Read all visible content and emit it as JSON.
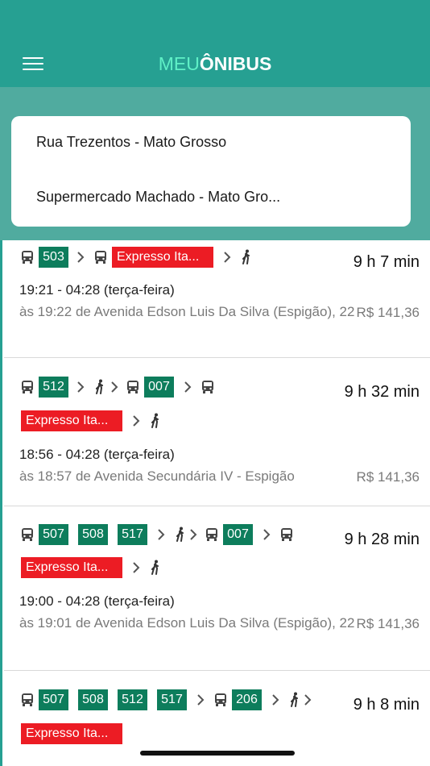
{
  "header": {
    "logo_light": "MEU",
    "logo_bold": "ÔNIBUS"
  },
  "search": {
    "origin": "Rua Trezentos - Mato Grosso",
    "destination": "Supermercado Machado - Mato Gro..."
  },
  "routes": [
    {
      "lines": [
        "503",
        "Expresso Ita..."
      ],
      "duration": "9 h 7 min",
      "time": "19:21 - 04:28 (terça-feira)",
      "desc": "às 19:22 de Avenida Edson Luis Da Silva (Espigão), 22",
      "price": "R$ 141,36"
    },
    {
      "lines": [
        "512",
        "007",
        "Expresso Ita..."
      ],
      "duration": "9 h 32 min",
      "time": "18:56 - 04:28 (terça-feira)",
      "desc": "às 18:57 de Avenida Secundária IV - Espigão",
      "price": "R$ 141,36"
    },
    {
      "lines": [
        "507",
        "508",
        "517",
        "007",
        "Expresso Ita..."
      ],
      "duration": "9 h 28 min",
      "time": "19:00 - 04:28 (terça-feira)",
      "desc": "às 19:01 de Avenida Edson Luis Da Silva (Espigão), 22",
      "price": "R$ 141,36"
    },
    {
      "lines": [
        "507",
        "508",
        "512",
        "517",
        "206",
        "Expresso Ita..."
      ],
      "duration": "9 h 8 min"
    }
  ],
  "colors": {
    "header": "#26a092",
    "search_band": "#50ab9f",
    "line_badge": "#0d7d5c",
    "express_badge": "#ec1c24",
    "logo_accent": "#5ff0c6"
  },
  "icons": [
    "menu-icon",
    "bus-icon",
    "chevron-right-icon",
    "walk-icon"
  ]
}
